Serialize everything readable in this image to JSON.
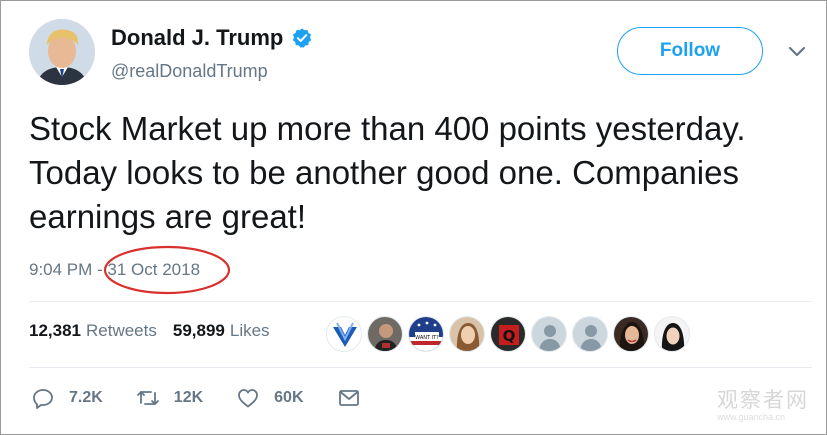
{
  "user": {
    "name": "Donald J. Trump",
    "handle": "@realDonaldTrump",
    "verified": true
  },
  "follow_label": "Follow",
  "tweet": {
    "text": "Stock Market up more than 400 points yesterday. Today looks to be another good one. Companies earnings are great!",
    "time": "9:04 PM",
    "separator": " - ",
    "date": "31 Oct 2018"
  },
  "stats": {
    "retweets_count": "12,381",
    "retweets_label": "Retweets",
    "likes_count": "59,899",
    "likes_label": "Likes"
  },
  "likers": [
    {
      "icon": "avatar-blue-logo-icon"
    },
    {
      "icon": "avatar-person-icon"
    },
    {
      "icon": "avatar-flag-badge-icon"
    },
    {
      "icon": "avatar-woman-icon"
    },
    {
      "icon": "avatar-red-q-icon"
    },
    {
      "icon": "avatar-default-icon"
    },
    {
      "icon": "avatar-default-icon"
    },
    {
      "icon": "avatar-woman-icon"
    },
    {
      "icon": "avatar-woman-icon"
    }
  ],
  "actions": {
    "reply_count": "7.2K",
    "retweet_count": "12K",
    "like_count": "60K"
  },
  "watermark": {
    "text": "观察者网",
    "url": "www.guancha.cn"
  },
  "colors": {
    "accent": "#1da1f2",
    "secondary_text": "#657786",
    "annotation_circle": "#d9302b"
  }
}
